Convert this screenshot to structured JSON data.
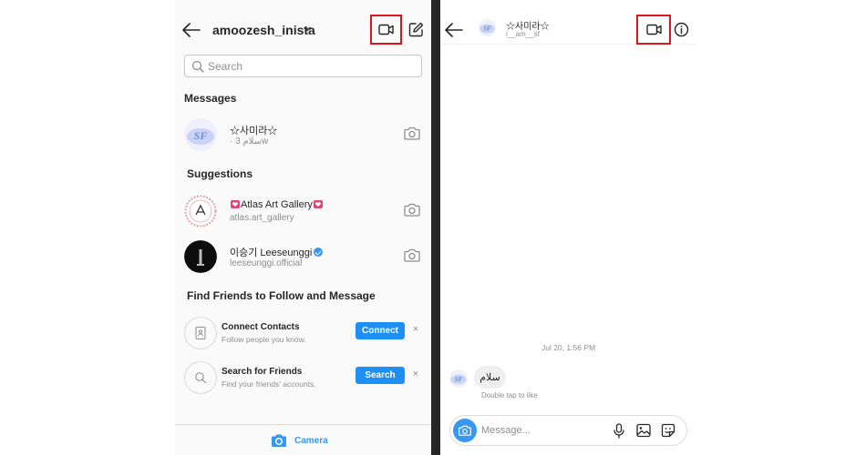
{
  "left_screen": {
    "header": {
      "account_name": "amoozesh_inista",
      "back_icon": "arrow-left-icon",
      "dropdown_icon": "chevron-down-icon",
      "video_icon": "video-call-icon",
      "compose_icon": "new-message-icon"
    },
    "search": {
      "placeholder": "Search",
      "value": ""
    },
    "messages_title": "Messages",
    "messages": [
      {
        "name": "☆사미라☆",
        "subtitle": "· سلام 3w",
        "avatar_text": "SF"
      }
    ],
    "suggestions_title": "Suggestions",
    "suggestions": [
      {
        "name": "Atlas Art Gallery",
        "username": "atlas.art_gallery"
      },
      {
        "name": "이승기 Leeseunggi",
        "username": "leeseunggi.official",
        "verified": true
      }
    ],
    "find_friends_title": "Find Friends to Follow and Message",
    "find_friends": [
      {
        "title": "Connect Contacts",
        "subtitle": "Follow people you know.",
        "button": "Connect",
        "dismiss": "×"
      },
      {
        "title": "Search for Friends",
        "subtitle": "Find your friends' accounts.",
        "button": "Search",
        "dismiss": "×"
      }
    ],
    "bottom_bar": {
      "label": "Camera"
    }
  },
  "right_screen": {
    "header": {
      "name": "☆사미라☆",
      "username": "i__am__sf",
      "avatar_text": "SF"
    },
    "timestamp": "Jul 20, 1:56 PM",
    "message": {
      "text": "سلام",
      "hint": "Double tap to like",
      "avatar_text": "SF"
    },
    "composer": {
      "placeholder": "Message..."
    }
  },
  "colors": {
    "highlight_border": "#e0141e",
    "button_blue": "#1d8ff5",
    "link_blue": "#3897f0",
    "divider": "#262626",
    "heart_pink": "#e5407e"
  }
}
